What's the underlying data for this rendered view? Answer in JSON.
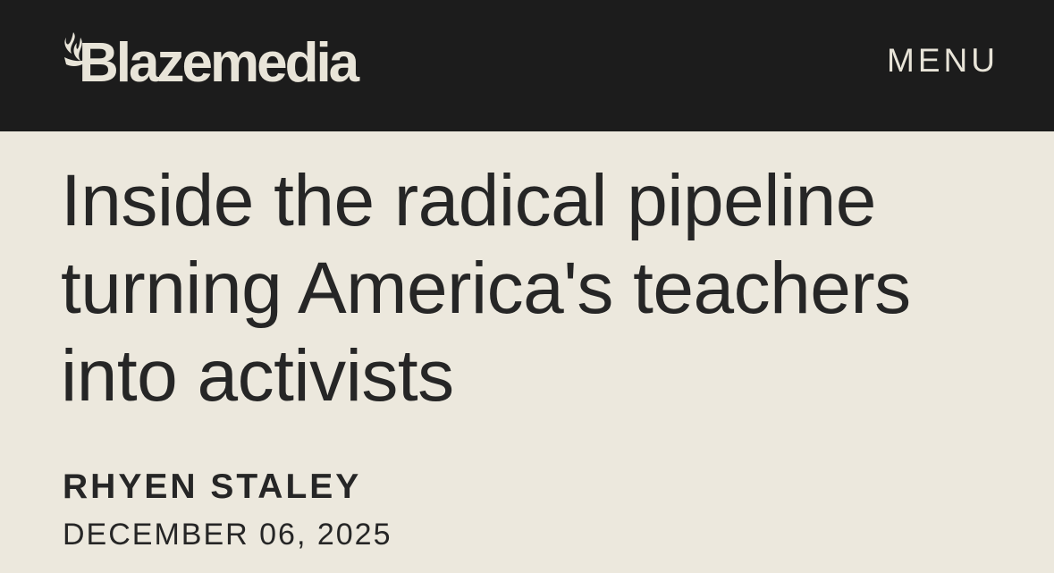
{
  "header": {
    "logo_text": "Blazemedia",
    "logo_icon": "blaze-flame-icon",
    "menu_label": "MENU"
  },
  "article": {
    "headline": "Inside the radical pipeline turning America's teachers into activists",
    "author": "RHYEN STALEY",
    "date": "DECEMBER 06, 2025"
  },
  "colors": {
    "header_bg": "#1c1c1c",
    "page_bg": "#ece8dd",
    "header_text": "#e8e4d8",
    "body_text": "#262626"
  }
}
